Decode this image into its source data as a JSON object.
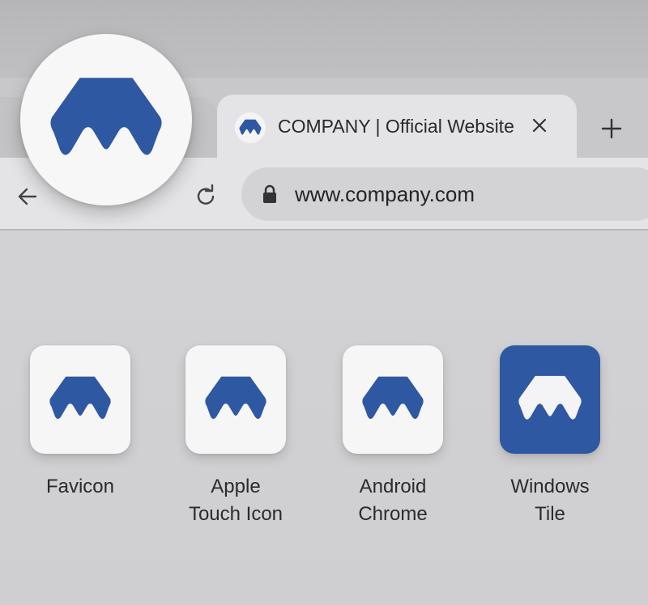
{
  "browser": {
    "tab": {
      "title": "COMPANY | Official Website",
      "favicon": "company-logo-icon",
      "close_icon": "close-icon"
    },
    "new_tab_icon": "plus-icon",
    "toolbar": {
      "back_icon": "back-arrow-icon",
      "reload_icon": "reload-icon",
      "lock_icon": "lock-icon",
      "url": "www.company.com"
    }
  },
  "magnified_logo": "company-logo-icon",
  "icon_variants": [
    {
      "line1": "Favicon",
      "line2": "",
      "style": "white"
    },
    {
      "line1": "Apple",
      "line2": "Touch Icon",
      "style": "white"
    },
    {
      "line1": "Android",
      "line2": "Chrome",
      "style": "white"
    },
    {
      "line1": "Windows",
      "line2": "Tile",
      "style": "blue"
    }
  ],
  "colors": {
    "brand_blue": "#2f58a3",
    "tile_white": "#f6f6f7",
    "background": "#d2d2d4"
  }
}
